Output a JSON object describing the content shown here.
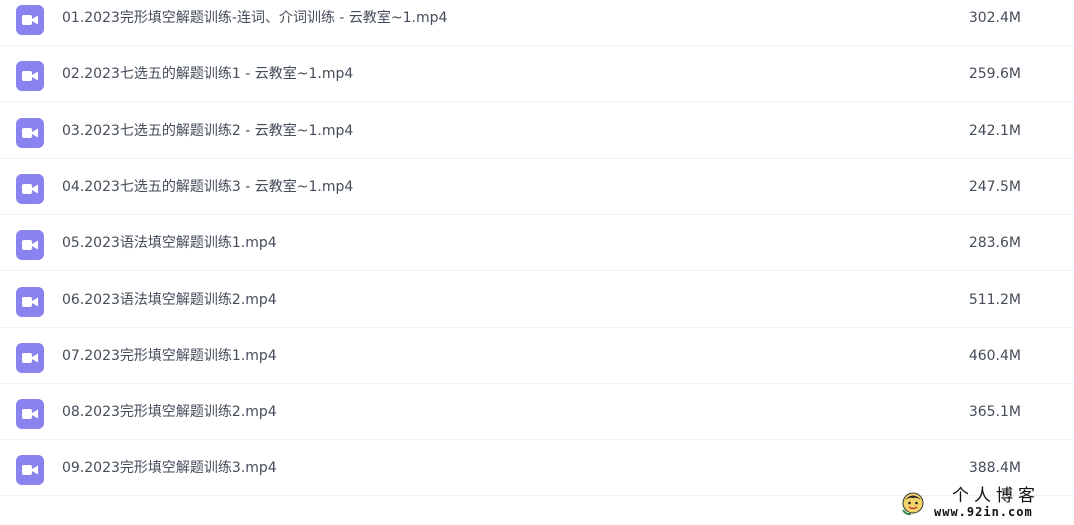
{
  "files": [
    {
      "name": "01.2023完形填空解题训练-连词、介词训练 - 云教室~1.mp4",
      "size": "302.4M",
      "icon": "video-file-icon"
    },
    {
      "name": "02.2023七选五的解题训练1 - 云教室~1.mp4",
      "size": "259.6M",
      "icon": "video-file-icon"
    },
    {
      "name": "03.2023七选五的解题训练2 - 云教室~1.mp4",
      "size": "242.1M",
      "icon": "video-file-icon"
    },
    {
      "name": "04.2023七选五的解题训练3 - 云教室~1.mp4",
      "size": "247.5M",
      "icon": "video-file-icon"
    },
    {
      "name": "05.2023语法填空解题训练1.mp4",
      "size": "283.6M",
      "icon": "video-file-icon"
    },
    {
      "name": "06.2023语法填空解题训练2.mp4",
      "size": "511.2M",
      "icon": "video-file-icon"
    },
    {
      "name": "07.2023完形填空解题训练1.mp4",
      "size": "460.4M",
      "icon": "video-file-icon"
    },
    {
      "name": "08.2023完形填空解题训练2.mp4",
      "size": "365.1M",
      "icon": "video-file-icon"
    },
    {
      "name": "09.2023完形填空解题训练3.mp4",
      "size": "388.4M",
      "icon": "video-file-icon"
    }
  ],
  "watermark": {
    "title": "个人博客",
    "url": "www.92in.com"
  },
  "colors": {
    "icon": "#8a83ef",
    "text": "#454d5a",
    "divider": "#f0f0f2"
  }
}
